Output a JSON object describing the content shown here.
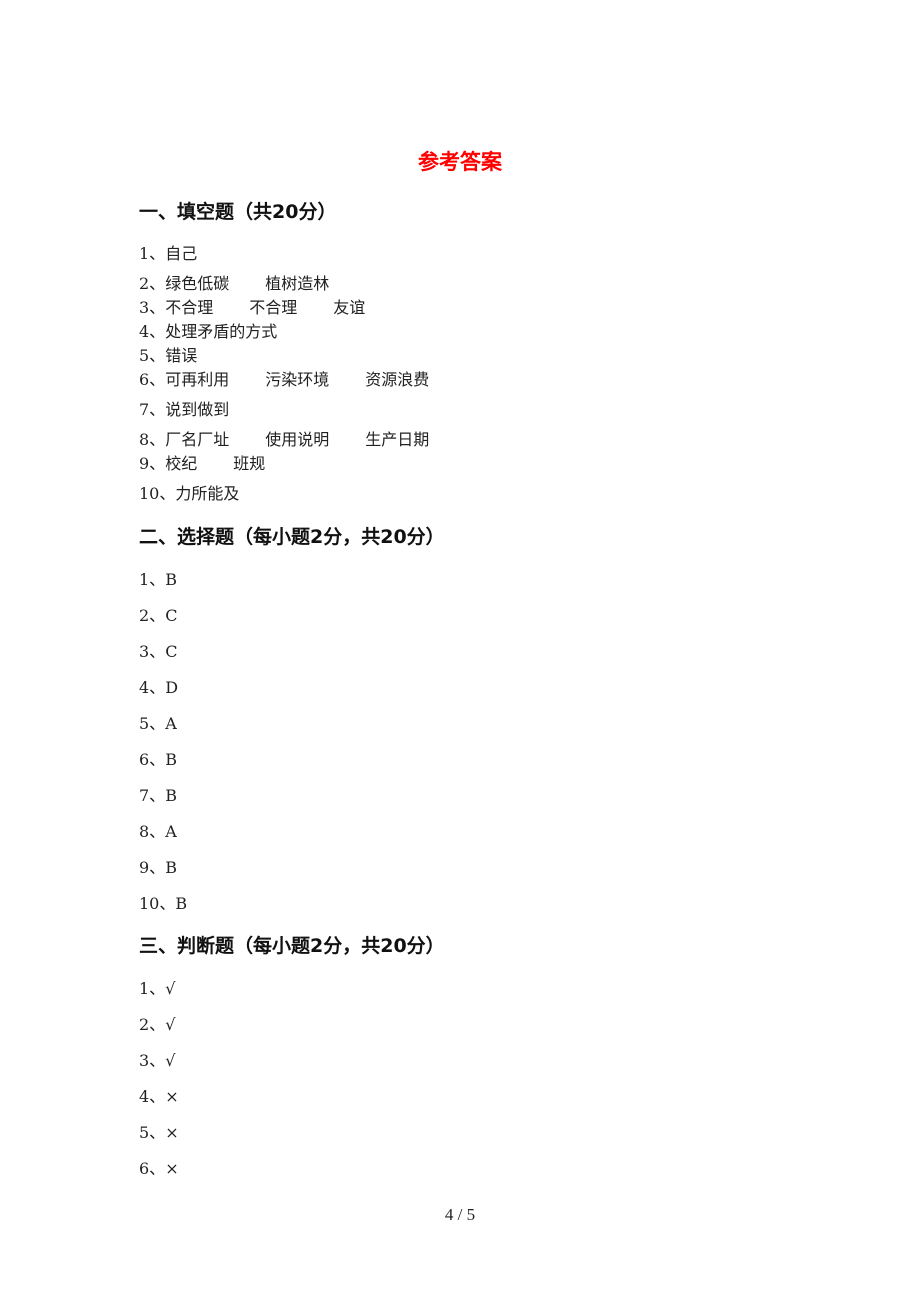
{
  "title": "参考答案",
  "sections": [
    {
      "heading": "一、填空题（共20分）",
      "items": [
        {
          "num": "1、",
          "answers": [
            "自己"
          ]
        },
        {
          "num": "2、",
          "answers": [
            "绿色低碳",
            "植树造林"
          ]
        },
        {
          "num": "3、",
          "answers": [
            "不合理",
            "不合理",
            "友谊"
          ]
        },
        {
          "num": "4、",
          "answers": [
            "处理矛盾的方式"
          ]
        },
        {
          "num": "5、",
          "answers": [
            "错误"
          ]
        },
        {
          "num": "6、",
          "answers": [
            "可再利用",
            "污染环境",
            "资源浪费"
          ]
        },
        {
          "num": "7、",
          "answers": [
            "说到做到"
          ]
        },
        {
          "num": "8、",
          "answers": [
            "厂名厂址",
            "使用说明",
            "生产日期"
          ]
        },
        {
          "num": "9、",
          "answers": [
            "校纪",
            "班规"
          ]
        },
        {
          "num": "10、",
          "answers": [
            "力所能及"
          ]
        }
      ]
    },
    {
      "heading": "二、选择题（每小题2分，共20分）",
      "items": [
        {
          "num": "1、",
          "answers": [
            "B"
          ]
        },
        {
          "num": "2、",
          "answers": [
            "C"
          ]
        },
        {
          "num": "3、",
          "answers": [
            "C"
          ]
        },
        {
          "num": "4、",
          "answers": [
            "D"
          ]
        },
        {
          "num": "5、",
          "answers": [
            "A"
          ]
        },
        {
          "num": "6、",
          "answers": [
            "B"
          ]
        },
        {
          "num": "7、",
          "answers": [
            "B"
          ]
        },
        {
          "num": "8、",
          "answers": [
            "A"
          ]
        },
        {
          "num": "9、",
          "answers": [
            "B"
          ]
        },
        {
          "num": "10、",
          "answers": [
            "B"
          ]
        }
      ]
    },
    {
      "heading": "三、判断题（每小题2分，共20分）",
      "items": [
        {
          "num": "1、",
          "answers": [
            "√"
          ]
        },
        {
          "num": "2、",
          "answers": [
            "√"
          ]
        },
        {
          "num": "3、",
          "answers": [
            "√"
          ]
        },
        {
          "num": "4、",
          "answers": [
            "×"
          ]
        },
        {
          "num": "5、",
          "answers": [
            "×"
          ]
        },
        {
          "num": "6、",
          "answers": [
            "×"
          ]
        }
      ]
    }
  ],
  "footer": {
    "page_indicator": "4 / 5"
  }
}
